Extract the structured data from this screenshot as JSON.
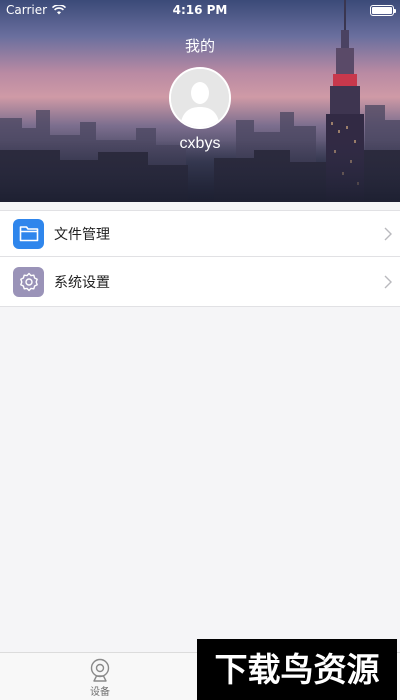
{
  "status_bar": {
    "carrier": "Carrier",
    "time": "4:16 PM"
  },
  "header": {
    "title": "我的",
    "username": "cxbys"
  },
  "menu": [
    {
      "label": "文件管理",
      "icon": "folder-icon",
      "icon_color": "#2f86ec"
    },
    {
      "label": "系统设置",
      "icon": "gear-icon",
      "icon_color": "#9a93b8"
    }
  ],
  "tabbar": {
    "tabs": [
      {
        "label": "设备",
        "icon": "camera-icon"
      }
    ]
  },
  "watermark": {
    "text": "下载鸟资源"
  }
}
